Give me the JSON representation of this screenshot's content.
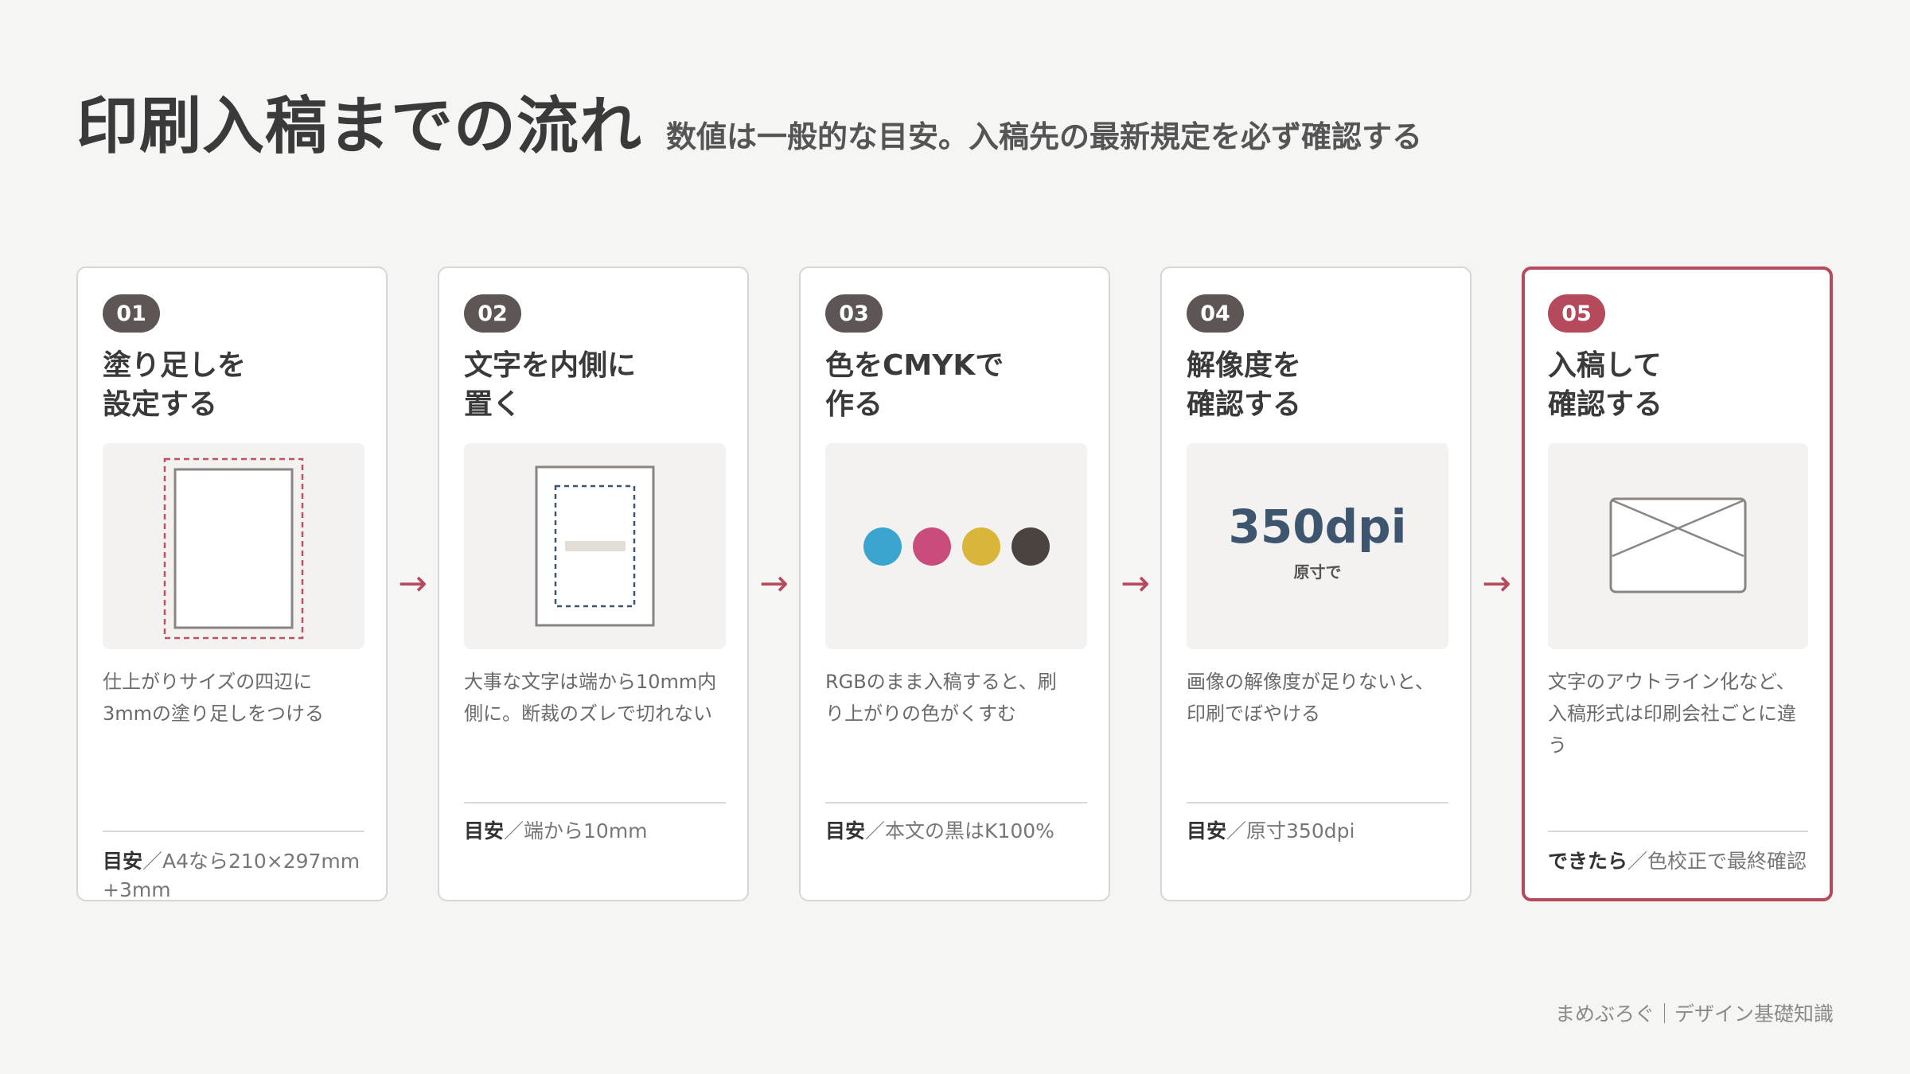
{
  "header": {
    "title": "印刷入稿までの流れ",
    "subtitle": "数値は一般的な目安。入稿先の最新規定を必ず確認する"
  },
  "colors": {
    "accent": "#b54a5c",
    "badge": "#5d5655",
    "cyan": "#3aa6cf",
    "magenta": "#c94c7c",
    "yellow": "#d9b63a",
    "black": "#4a433f",
    "dpi_text": "#3e5570"
  },
  "arrow_glyph": "→",
  "steps": [
    {
      "number": "01",
      "title": "塗り足しを\n設定する",
      "illustration": "bleed-page",
      "desc": "仕上がりサイズの四辺に\n3mmの塗り足しをつける",
      "meta_label": "目安",
      "meta_text": "／A4なら210×297mm\n+3mm"
    },
    {
      "number": "02",
      "title": "文字を内側に\n置く",
      "illustration": "safe-area-page",
      "desc": "大事な文字は端から10mm内\n側に。断裁のズレで切れない",
      "meta_label": "目安",
      "meta_text": "／端から10mm"
    },
    {
      "number": "03",
      "title": "色をCMYKで\n作る",
      "illustration": "cmyk-dots",
      "desc": "RGBのまま入稿すると、刷\nり上がりの色がくすむ",
      "meta_label": "目安",
      "meta_text": "／本文の黒はK100%"
    },
    {
      "number": "04",
      "title": "解像度を\n確認する",
      "illustration": "dpi-readout",
      "dpi_value": "350dpi",
      "dpi_note": "原寸で",
      "desc": "画像の解像度が足りないと、\n印刷でぼやける",
      "meta_label": "目安",
      "meta_text": "／原寸350dpi"
    },
    {
      "number": "05",
      "title": "入稿して\n確認する",
      "illustration": "envelope",
      "desc": "文字のアウトライン化など、\n入稿形式は印刷会社ごとに違\nう",
      "meta_label": "できたら",
      "meta_text": "／色校正で最終確認"
    }
  ],
  "footer": {
    "text": "まめぶろぐ｜デザイン基礎知識"
  }
}
